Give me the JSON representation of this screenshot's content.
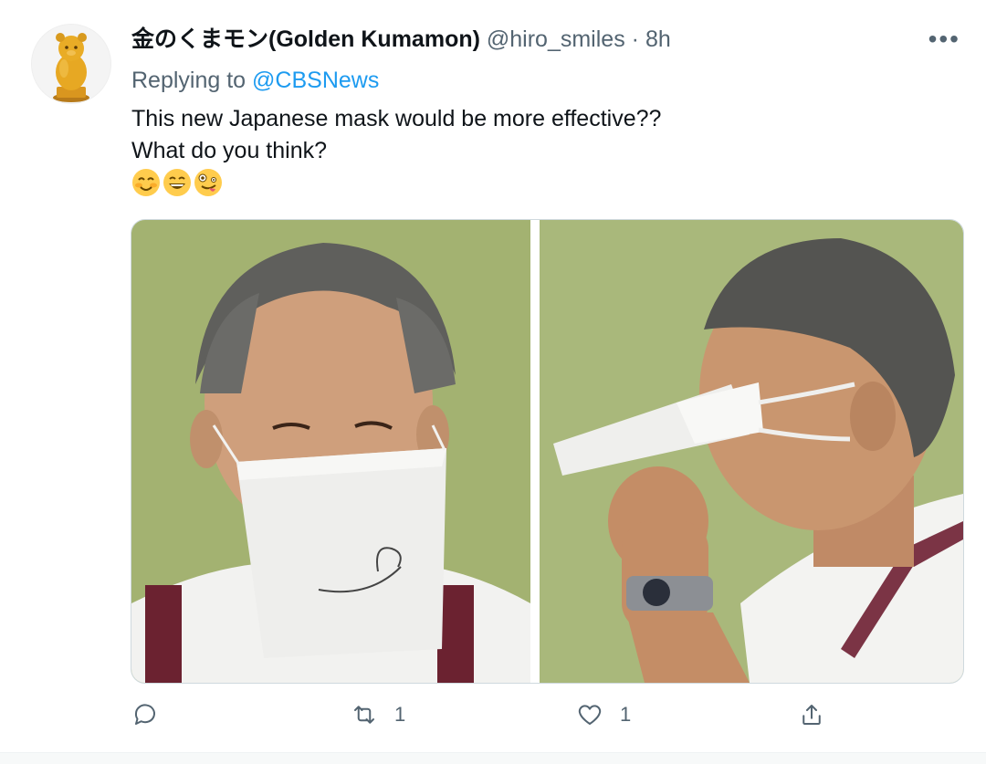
{
  "tweet": {
    "display_name": "金のくまモン(Golden Kumamon)",
    "handle": "@hiro_smiles",
    "separator": "·",
    "time": "8h",
    "more_label": "•••",
    "replying_prefix": "Replying to",
    "replying_to": "@CBSNews",
    "text_line1": "This new Japanese mask would be more effective??",
    "text_line2": "What do you think?",
    "emojis": [
      "smiling-face-with-blush-emoji",
      "grinning-face-emoji",
      "zany-face-emoji"
    ]
  },
  "actions": {
    "reply_count": "",
    "retweet_count": "1",
    "like_count": "1"
  },
  "colors": {
    "accent": "#1d9bf0",
    "secondary_text": "#536471",
    "primary_text": "#0f1419"
  }
}
